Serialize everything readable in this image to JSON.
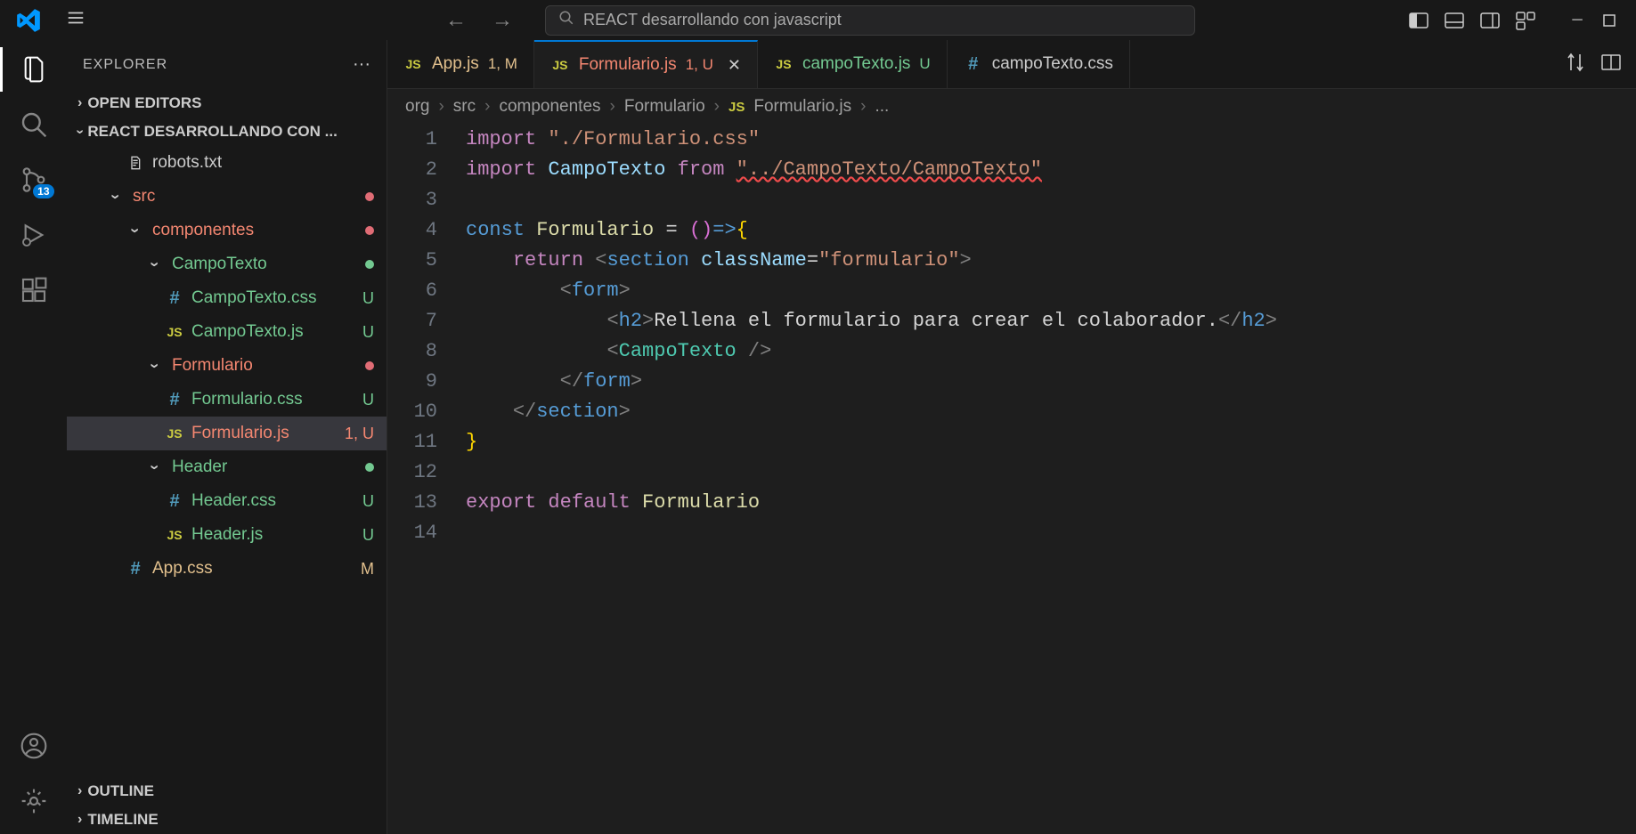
{
  "app": {
    "search_text": "REACT desarrollando con javascript"
  },
  "activity": {
    "scm_badge": "13"
  },
  "sidebar": {
    "title": "EXPLORER",
    "sections": {
      "open_editors": "OPEN EDITORS",
      "workspace": "REACT DESARROLLANDO CON ...",
      "outline": "OUTLINE",
      "timeline": "TIMELINE"
    },
    "tree": [
      {
        "indent": 3,
        "icon": "file",
        "label": "robots.txt",
        "color": "c-default",
        "status": "",
        "statusType": ""
      },
      {
        "indent": 2,
        "icon": "chevron-down",
        "label": "src",
        "color": "c-error",
        "status": "dot",
        "statusType": "dot-error"
      },
      {
        "indent": 3,
        "icon": "chevron-down",
        "label": "componentes",
        "color": "c-error",
        "status": "dot",
        "statusType": "dot-error"
      },
      {
        "indent": 4,
        "icon": "chevron-down",
        "label": "CampoTexto",
        "color": "c-untracked",
        "status": "dot",
        "statusType": "dot-untracked"
      },
      {
        "indent": 5,
        "icon": "hash",
        "label": "CampoTexto.css",
        "color": "c-untracked",
        "status": "U",
        "statusType": "c-untracked"
      },
      {
        "indent": 5,
        "icon": "js",
        "label": "CampoTexto.js",
        "color": "c-untracked",
        "status": "U",
        "statusType": "c-untracked"
      },
      {
        "indent": 4,
        "icon": "chevron-down",
        "label": "Formulario",
        "color": "c-error",
        "status": "dot",
        "statusType": "dot-error"
      },
      {
        "indent": 5,
        "icon": "hash",
        "label": "Formulario.css",
        "color": "c-untracked",
        "status": "U",
        "statusType": "c-untracked"
      },
      {
        "indent": 5,
        "icon": "js",
        "label": "Formulario.js",
        "color": "c-error",
        "status": "1, U",
        "statusType": "c-error",
        "selected": true
      },
      {
        "indent": 4,
        "icon": "chevron-down",
        "label": "Header",
        "color": "c-untracked",
        "status": "dot",
        "statusType": "dot-untracked"
      },
      {
        "indent": 5,
        "icon": "hash",
        "label": "Header.css",
        "color": "c-untracked",
        "status": "U",
        "statusType": "c-untracked"
      },
      {
        "indent": 5,
        "icon": "js",
        "label": "Header.js",
        "color": "c-untracked",
        "status": "U",
        "statusType": "c-untracked"
      },
      {
        "indent": 3,
        "icon": "hash",
        "label": "App.css",
        "color": "c-modified",
        "status": "M",
        "statusType": "c-modified"
      }
    ]
  },
  "tabs": [
    {
      "icon": "js",
      "label": "App.js",
      "labelColor": "c-modified",
      "badge": "1, M",
      "badgeColor": "c-modified",
      "active": false
    },
    {
      "icon": "js",
      "label": "Formulario.js",
      "labelColor": "c-error",
      "badge": "1, U",
      "badgeColor": "c-error",
      "active": true,
      "close": true
    },
    {
      "icon": "js",
      "label": "campoTexto.js",
      "labelColor": "c-untracked",
      "badge": "U",
      "badgeColor": "c-untracked",
      "active": false
    },
    {
      "icon": "hash",
      "label": "campoTexto.css",
      "labelColor": "c-default",
      "badge": "",
      "badgeColor": "",
      "active": false,
      "truncated": true
    }
  ],
  "breadcrumb": {
    "parts": [
      "org",
      "src",
      "componentes",
      "Formulario"
    ],
    "file": "Formulario.js",
    "trailing": "..."
  },
  "code": {
    "lines": [
      [
        {
          "t": "import ",
          "c": "tk-keyword"
        },
        {
          "t": "\"./Formulario.css\"",
          "c": "tk-string"
        }
      ],
      [
        {
          "t": "import ",
          "c": "tk-keyword"
        },
        {
          "t": "CampoTexto",
          "c": "tk-var"
        },
        {
          "t": " from ",
          "c": "tk-keyword"
        },
        {
          "t": "\"../CampoTexto/CampoTexto\"",
          "c": "tk-string-err"
        }
      ],
      [],
      [
        {
          "t": "const ",
          "c": "tk-const"
        },
        {
          "t": "Formulario",
          "c": "tk-func"
        },
        {
          "t": " = ",
          "c": "tk-punct"
        },
        {
          "t": "()",
          "c": "tk-bracket"
        },
        {
          "t": "=>",
          "c": "tk-const"
        },
        {
          "t": "{",
          "c": "tk-brace"
        }
      ],
      [
        {
          "t": "    ",
          "c": ""
        },
        {
          "t": "return ",
          "c": "tk-keyword"
        },
        {
          "t": "<",
          "c": "tk-angle"
        },
        {
          "t": "section",
          "c": "tk-tag"
        },
        {
          "t": " ",
          "c": ""
        },
        {
          "t": "className",
          "c": "tk-attr"
        },
        {
          "t": "=",
          "c": "tk-punct"
        },
        {
          "t": "\"formulario\"",
          "c": "tk-string"
        },
        {
          "t": ">",
          "c": "tk-angle"
        }
      ],
      [
        {
          "t": "        ",
          "c": ""
        },
        {
          "t": "<",
          "c": "tk-angle"
        },
        {
          "t": "form",
          "c": "tk-tag"
        },
        {
          "t": ">",
          "c": "tk-angle"
        }
      ],
      [
        {
          "t": "            ",
          "c": ""
        },
        {
          "t": "<",
          "c": "tk-angle"
        },
        {
          "t": "h2",
          "c": "tk-tag"
        },
        {
          "t": ">",
          "c": "tk-angle"
        },
        {
          "t": "Rellena el formulario para crear el colaborador.",
          "c": "tk-punct"
        },
        {
          "t": "</",
          "c": "tk-angle"
        },
        {
          "t": "h2",
          "c": "tk-tag"
        },
        {
          "t": ">",
          "c": "tk-angle"
        }
      ],
      [
        {
          "t": "            ",
          "c": ""
        },
        {
          "t": "<",
          "c": "tk-angle"
        },
        {
          "t": "CampoTexto",
          "c": "tk-comp"
        },
        {
          "t": " />",
          "c": "tk-angle"
        }
      ],
      [
        {
          "t": "        ",
          "c": ""
        },
        {
          "t": "</",
          "c": "tk-angle"
        },
        {
          "t": "form",
          "c": "tk-tag"
        },
        {
          "t": ">",
          "c": "tk-angle"
        }
      ],
      [
        {
          "t": "    ",
          "c": ""
        },
        {
          "t": "</",
          "c": "tk-angle"
        },
        {
          "t": "section",
          "c": "tk-tag"
        },
        {
          "t": ">",
          "c": "tk-angle"
        }
      ],
      [
        {
          "t": "}",
          "c": "tk-brace"
        }
      ],
      [],
      [
        {
          "t": "export default ",
          "c": "tk-keyword"
        },
        {
          "t": "Formulario",
          "c": "tk-func"
        }
      ],
      []
    ]
  }
}
